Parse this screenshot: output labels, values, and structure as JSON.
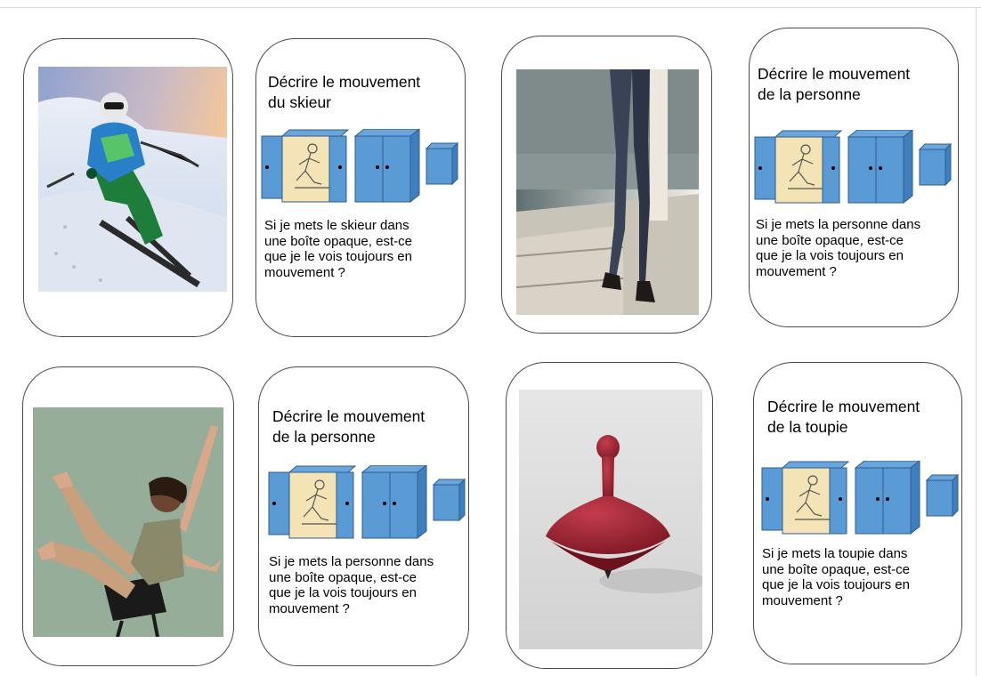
{
  "colors": {
    "box_blue": "#5b9bd5",
    "box_blue_dark": "#3f7fbf",
    "box_outline": "#2e5e8e",
    "door_panel": "#f3e3b5",
    "card_border": "#4a4a4a"
  },
  "cards": [
    {
      "photo": "skier-photo",
      "title": "Décrire le mouvement\ndu skieur",
      "question": "Si je mets le skieur dans\nune boîte opaque, est-ce\nque je le vois toujours en\nmouvement ?"
    },
    {
      "photo": "walking-person-photo",
      "title": "Décrire le mouvement\nde la personne",
      "question": "Si je mets la personne dans\nune boîte opaque, est-ce\nque je la vois toujours en\nmouvement ?"
    },
    {
      "photo": "falling-chair-person-photo",
      "title": "Décrire le mouvement\nde la personne",
      "question": "Si je mets la personne dans\nune boîte opaque, est-ce\nque je la vois toujours en\nmouvement ?"
    },
    {
      "photo": "spinning-top-photo",
      "title": "Décrire le mouvement\nde la toupie",
      "question": "Si je mets la toupie dans\nune boîte opaque, est-ce\nque je la vois toujours en\nmouvement ?"
    }
  ]
}
